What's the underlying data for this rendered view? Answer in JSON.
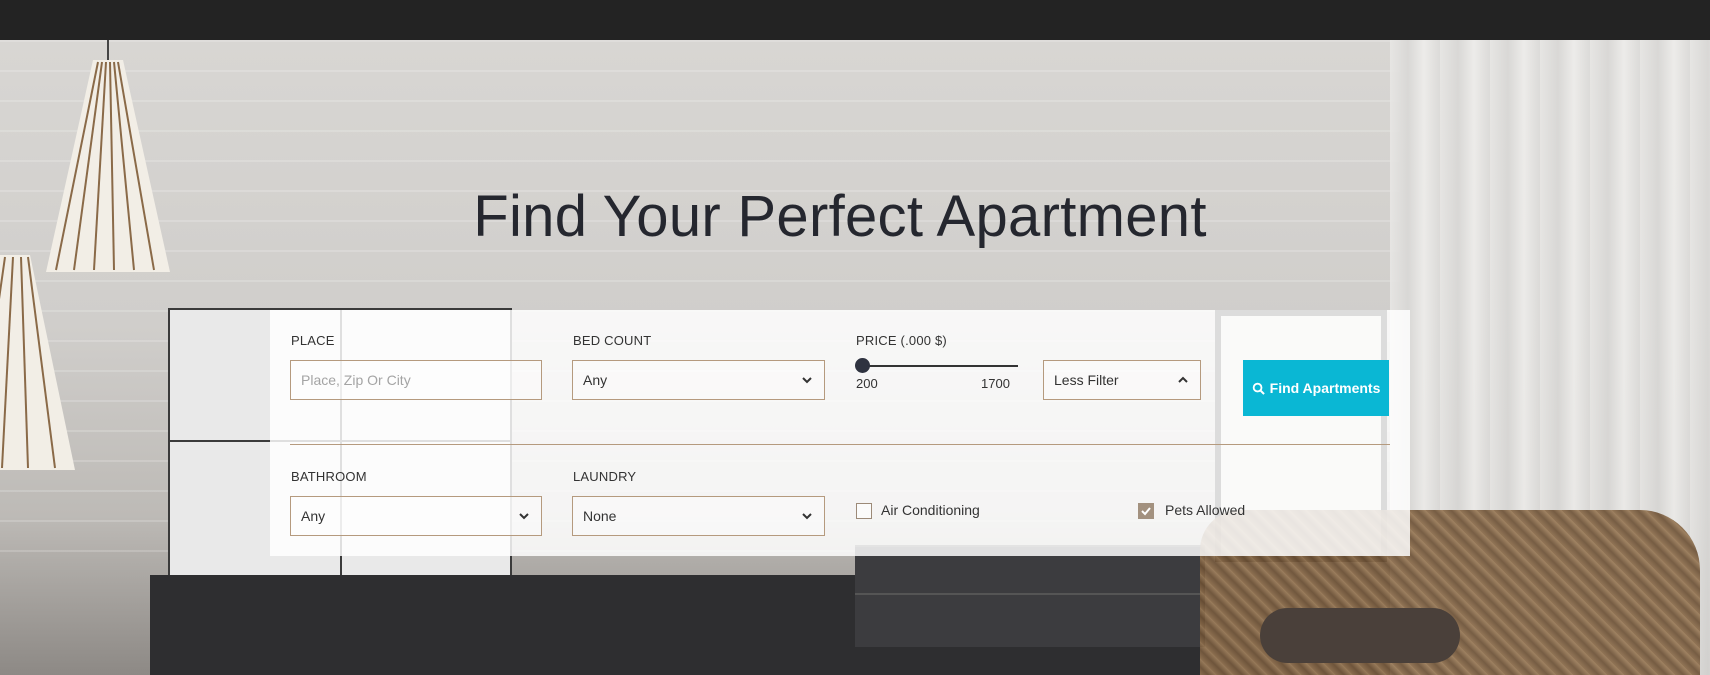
{
  "page": {
    "headline": "Find Your Perfect Apartment"
  },
  "search": {
    "place": {
      "label": "PLACE",
      "placeholder": "Place, Zip Or City",
      "value": ""
    },
    "bed_count": {
      "label": "BED COUNT",
      "selected": "Any"
    },
    "price": {
      "label": "PRICE (.000 $)",
      "min": "200",
      "max": "1700",
      "position": 0
    },
    "filter_toggle": {
      "label": "Less Filter"
    },
    "find_button": {
      "label": "Find Apartments"
    },
    "bathroom": {
      "label": "BATHROOM",
      "selected": "Any"
    },
    "laundry": {
      "label": "LAUNDRY",
      "selected": "None"
    },
    "air_conditioning": {
      "label": "Air Conditioning",
      "checked": false
    },
    "pets_allowed": {
      "label": "Pets Allowed",
      "checked": true
    }
  },
  "colors": {
    "accent": "#0ab7d4",
    "nav_background": "#232323",
    "field_border": "#b59a7e",
    "headline": "#25272f"
  },
  "icons": {
    "dropdown": "chevron-down-icon",
    "collapse": "chevron-up-icon",
    "search": "search-icon",
    "check": "check-icon"
  }
}
